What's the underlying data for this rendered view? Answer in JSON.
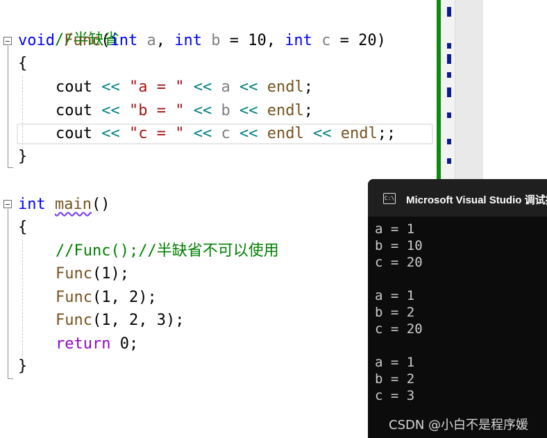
{
  "code": {
    "l1": [
      "//半缺省"
    ],
    "l2": [
      "void",
      " ",
      "Func",
      "(",
      "int",
      " ",
      "a",
      ", ",
      "int",
      " ",
      "b",
      " = 10, ",
      "int",
      " ",
      "c",
      " = 20)"
    ],
    "l3": [
      "{"
    ],
    "l4": [
      "cout",
      " ",
      "<<",
      " ",
      "\"a = \"",
      " ",
      "<<",
      " ",
      "a",
      " ",
      "<<",
      " ",
      "endl",
      ";"
    ],
    "l5": [
      "cout",
      " ",
      "<<",
      " ",
      "\"b = \"",
      " ",
      "<<",
      " ",
      "b",
      " ",
      "<<",
      " ",
      "endl",
      ";"
    ],
    "l6": [
      "cout",
      " ",
      "<<",
      " ",
      "\"c = \"",
      " ",
      "<<",
      " ",
      "c",
      " ",
      "<<",
      " ",
      "endl",
      " ",
      "<<",
      " ",
      "endl",
      ";;"
    ],
    "l7": [
      "}"
    ],
    "l8": [
      "int",
      " ",
      "main",
      "()"
    ],
    "l9": [
      "{"
    ],
    "l10": [
      "//Func();//半缺省不可以使用"
    ],
    "l11": [
      "Func",
      "(1);"
    ],
    "l12": [
      "Func",
      "(1, 2);"
    ],
    "l13": [
      "Func",
      "(1, 2, 3);"
    ],
    "l14": [
      "return",
      " 0;"
    ],
    "l15": [
      "}"
    ]
  },
  "console": {
    "icon_text": "C:\\",
    "title": "Microsoft Visual Studio 调试控",
    "lines": [
      "a = 1",
      "b = 10",
      "c = 20",
      "",
      "a = 1",
      "b = 2",
      "c = 20",
      "",
      "a = 1",
      "b = 2",
      "c = 3"
    ]
  },
  "watermark": "CSDN @小白不是程序媛",
  "icons": {
    "fold": "collapse-minus-icon",
    "console": "console-app-icon"
  },
  "colors": {
    "keyword": "#0000ff",
    "function": "#74531f",
    "comment": "#008000",
    "string": "#a31515",
    "operator": "#008080",
    "parameter": "#808080",
    "return": "#8f08c4",
    "console_bg": "#0c0c0c"
  }
}
